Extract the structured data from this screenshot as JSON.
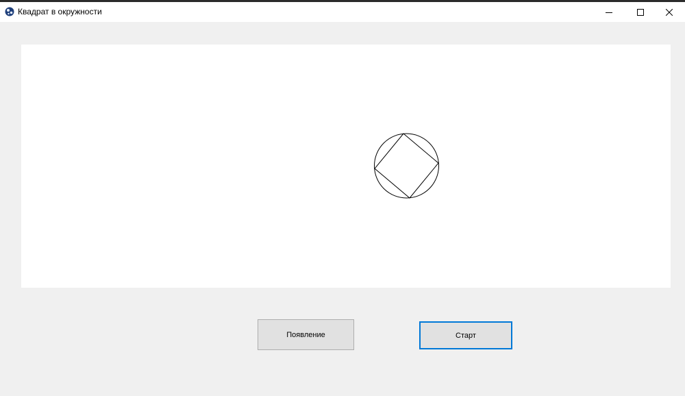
{
  "window": {
    "title": "Квадрат в окружности",
    "icon": "app-globe-icon",
    "controls": {
      "minimize": "minimize-icon",
      "maximize": "maximize-icon",
      "close": "close-icon"
    }
  },
  "canvas": {
    "background": "#ffffff",
    "shapes": {
      "circle": "circle",
      "square": "rotated-square-inscribed-in-circle"
    },
    "stroke_color": "#000000"
  },
  "buttons": {
    "appear_label": "Появление",
    "start_label": "Старт"
  },
  "colors": {
    "window_background": "#f0f0f0",
    "button_face": "#e1e1e1",
    "focus_border": "#0078d7"
  }
}
